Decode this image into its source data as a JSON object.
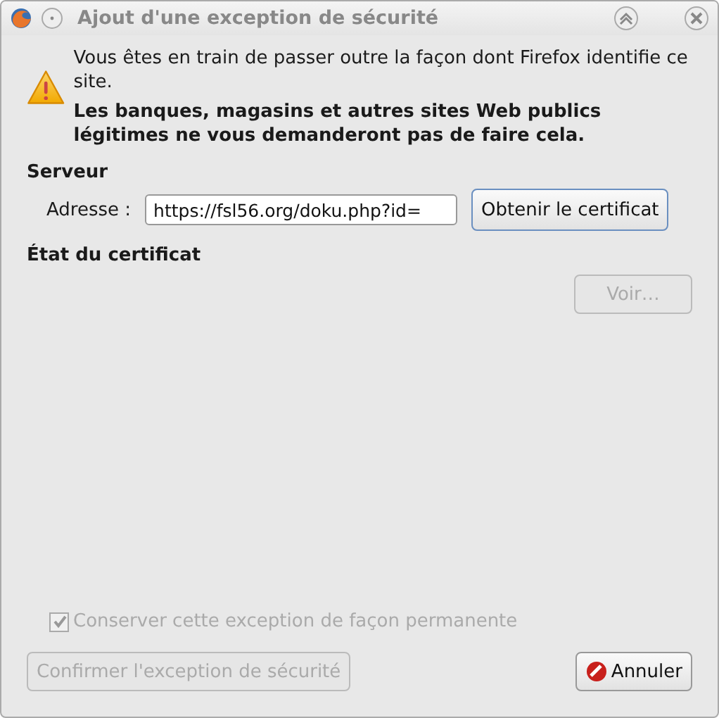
{
  "window": {
    "title": "Ajout d'une exception de sécurité"
  },
  "warning": {
    "message": "Vous êtes en train de passer outre la façon dont Firefox identifie ce site.",
    "emphasis": "Les banques, magasins et autres sites Web publics légitimes ne vous demanderont pas de faire cela."
  },
  "server": {
    "heading": "Serveur",
    "address_label": "Adresse :",
    "address_value": "https://fsl56.org/doku.php?id=",
    "get_button": {
      "label": "Obtenir le certificat",
      "disabled": false
    }
  },
  "certificate": {
    "heading": "État du certificat",
    "view_button": {
      "label": "Voir…",
      "disabled": true
    }
  },
  "permanent": {
    "label": "Conserver cette exception de façon permanente",
    "checked": true,
    "disabled": true
  },
  "buttons": [
    {
      "label": "Confirmer l'exception de sécurité",
      "kind": "confirm",
      "disabled": true
    },
    {
      "label": "Annuler",
      "kind": "cancel",
      "disabled": false
    }
  ]
}
